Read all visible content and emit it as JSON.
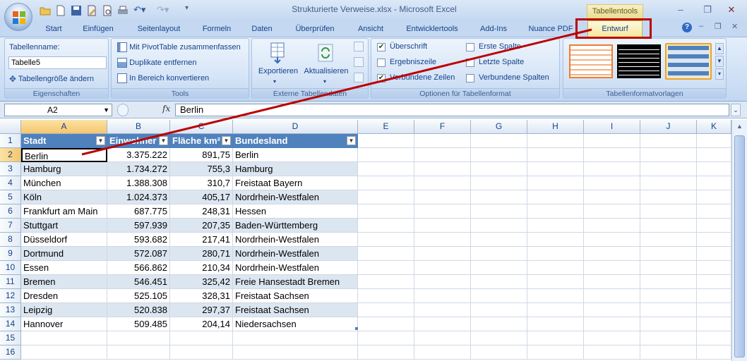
{
  "window": {
    "title": "Strukturierte Verweise.xlsx - Microsoft Excel",
    "context_tab_label": "Tabellentools"
  },
  "tabs": [
    "Start",
    "Einfügen",
    "Seitenlayout",
    "Formeln",
    "Daten",
    "Überprüfen",
    "Ansicht",
    "Entwicklertools",
    "Add-Ins",
    "Nuance PDF",
    "Entwurf"
  ],
  "ribbon": {
    "eigenschaften": {
      "title": "Eigenschaften",
      "name_label": "Tabellenname:",
      "name_value": "Tabelle5",
      "resize_label": "Tabellengröße ändern"
    },
    "tools": {
      "title": "Tools",
      "pivot": "Mit PivotTable zusammenfassen",
      "duplicates": "Duplikate entfernen",
      "convert": "In Bereich konvertieren"
    },
    "extern": {
      "title": "Externe Tabellendaten",
      "export": "Exportieren",
      "refresh": "Aktualisieren"
    },
    "optionen": {
      "title": "Optionen für Tabellenformat",
      "header_row": "Überschrift",
      "first_col": "Erste Spalte",
      "total_row": "Ergebniszeile",
      "last_col": "Letzte Spalte",
      "banded_rows": "Verbundene Zeilen",
      "banded_cols": "Verbundene Spalten",
      "header_row_checked": true,
      "first_col_checked": false,
      "total_row_checked": false,
      "last_col_checked": false,
      "banded_rows_checked": true,
      "banded_cols_checked": false
    },
    "vorlagen": {
      "title": "Tabellenformatvorlagen"
    }
  },
  "formula_bar": {
    "name_box": "A2",
    "fx": "fx",
    "content": "Berlin"
  },
  "columns": [
    "A",
    "B",
    "C",
    "D",
    "E",
    "F",
    "G",
    "H",
    "I",
    "J",
    "K"
  ],
  "table": {
    "headers": [
      "Stadt",
      "Einwohner",
      "Fläche km²",
      "Bundesland"
    ],
    "rows": [
      [
        "Berlin",
        "3.375.222",
        "891,75",
        "Berlin"
      ],
      [
        "Hamburg",
        "1.734.272",
        "755,3",
        "Hamburg"
      ],
      [
        "München",
        "1.388.308",
        "310,7",
        "Freistaat Bayern"
      ],
      [
        "Köln",
        "1.024.373",
        "405,17",
        "Nordrhein-Westfalen"
      ],
      [
        "Frankfurt am Main",
        "687.775",
        "248,31",
        "Hessen"
      ],
      [
        "Stuttgart",
        "597.939",
        "207,35",
        "Baden-Württemberg"
      ],
      [
        "Düsseldorf",
        "593.682",
        "217,41",
        "Nordrhein-Westfalen"
      ],
      [
        "Dortmund",
        "572.087",
        "280,71",
        "Nordrhein-Westfalen"
      ],
      [
        "Essen",
        "566.862",
        "210,34",
        "Nordrhein-Westfalen"
      ],
      [
        "Bremen",
        "546.451",
        "325,42",
        "Freie Hansestadt Bremen"
      ],
      [
        "Dresden",
        "525.105",
        "328,31",
        "Freistaat Sachsen"
      ],
      [
        "Leipzig",
        "520.838",
        "297,37",
        "Freistaat Sachsen"
      ],
      [
        "Hannover",
        "509.485",
        "204,14",
        "Niedersachsen"
      ]
    ]
  },
  "row_numbers": [
    "1",
    "2",
    "3",
    "4",
    "5",
    "6",
    "7",
    "8",
    "9",
    "10",
    "11",
    "12",
    "13",
    "14",
    "15",
    "16"
  ],
  "colors": {
    "table_header": "#4f81bd",
    "band": "#dce6f1",
    "annotation": "#bb0000"
  }
}
